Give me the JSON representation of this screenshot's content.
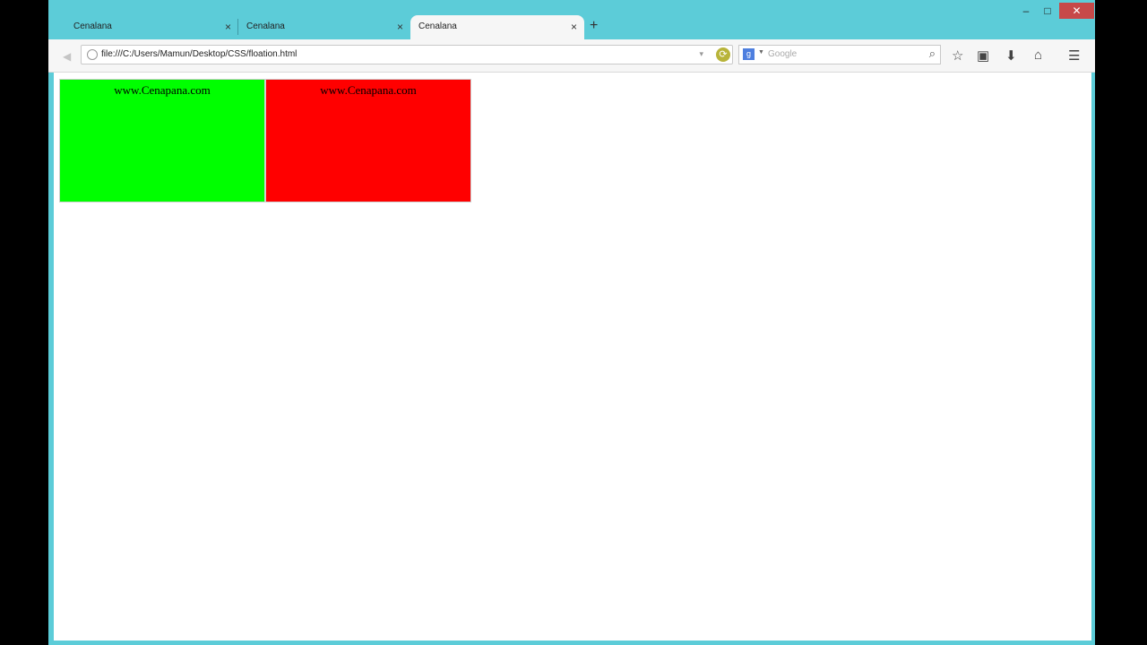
{
  "tabs": [
    {
      "label": "Cenalana"
    },
    {
      "label": "Cenalana"
    },
    {
      "label": "Cenalana"
    }
  ],
  "tab_close_glyph": "×",
  "new_tab_glyph": "+",
  "window_controls": {
    "minimize": "–",
    "maximize": "□",
    "close": "✕"
  },
  "address": {
    "url": "file:///C:/Users/Mamun/Desktop/CSS/floation.html"
  },
  "search": {
    "placeholder": "Google",
    "engine_letter": "g"
  },
  "page": {
    "boxes": [
      {
        "text": "www.Cenapana.com",
        "color": "#00ff00"
      },
      {
        "text": "www.Cenapana.com",
        "color": "#ff0000"
      }
    ]
  },
  "colors": {
    "frame": "#5cccd8",
    "close_button": "#c74949"
  }
}
